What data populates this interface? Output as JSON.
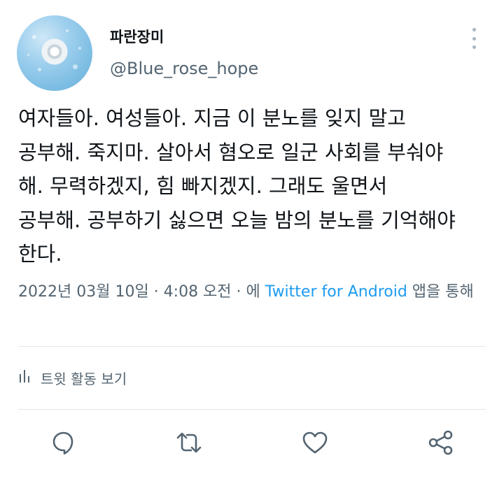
{
  "user": {
    "display_name": "파란장미",
    "handle": "@Blue_rose_hope"
  },
  "tweet": {
    "text": "여자들아. 여성들아. 지금 이 분노를 잊지 말고\n공부해. 죽지마. 살아서 혐오로 일군 사회를 부숴야\n해. 무력하겠지, 힘 빠지겠지. 그래도 울면서\n공부해. 공부하기 싫으면 오늘 밤의 분노를 기억해야\n한다."
  },
  "meta": {
    "timestamp": "2022년 03월 10일 · 4:08 오전 · 에 ",
    "source": "Twitter for Android",
    "suffix": " 앱을 통해"
  },
  "activity": {
    "label": "트윗 활동 보기"
  },
  "icons": {
    "reply": "reply-icon",
    "retweet": "retweet-icon",
    "like": "heart-icon",
    "share": "share-icon",
    "more": "more-vertical-icon",
    "activity": "bar-chart-icon"
  },
  "colors": {
    "text": "#0f1419",
    "secondary": "#536471",
    "accent": "#1d9bf0",
    "divider": "#e3e8ec"
  }
}
